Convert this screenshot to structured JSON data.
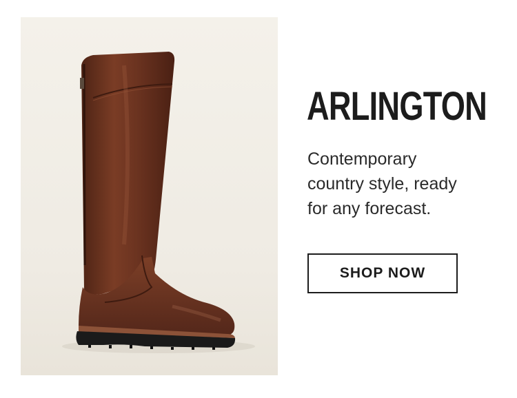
{
  "promo": {
    "headline": "ARLINGTON",
    "tagline_lines": [
      "Contemporary",
      "country style, ready",
      "for any forecast."
    ],
    "cta_label": "SHOP NOW"
  },
  "product_image": {
    "subject": "tall-brown-leather-riding-boot-icon"
  },
  "colors": {
    "background": "#ffffff",
    "photo_backdrop": "#f2efe8",
    "boot_leather": "#6b3420",
    "boot_sole": "#1a1a1a",
    "text": "#1c1c1c"
  }
}
